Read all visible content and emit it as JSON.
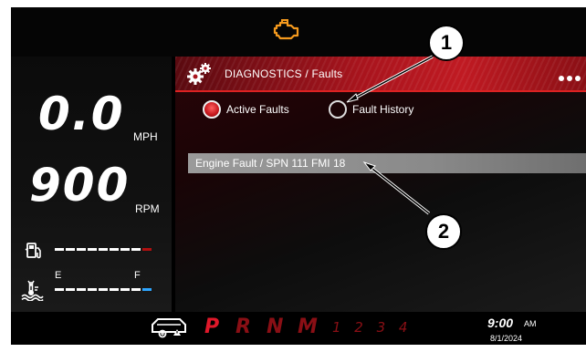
{
  "gauges": {
    "speed_value": "0.0",
    "speed_unit": "MPH",
    "rpm_value": "900",
    "rpm_unit": "RPM",
    "fuel_icon": "fuel-pump-icon",
    "temp_icon": "coolant-temperature-icon",
    "empty_label": "E",
    "full_label": "F"
  },
  "header": {
    "warning_icon": "check-engine-icon"
  },
  "diagnostics": {
    "icon": "gears-icon",
    "title": "DIAGNOSTICS / Faults",
    "options": [
      {
        "label": "Active Faults",
        "selected": true
      },
      {
        "label": "Fault History",
        "selected": false
      }
    ],
    "faults": [
      "Engine Fault / SPN 111 FMI 18"
    ]
  },
  "footer": {
    "transmission_icon": "transmission-warning-icon",
    "gears": [
      "P",
      "R",
      "N",
      "M"
    ],
    "gear_numbers": "1 2 3 4",
    "time": "9:00",
    "ampm": "AM",
    "date": "8/1/2024"
  },
  "callouts": [
    "1",
    "2"
  ],
  "colors": {
    "accent_red": "#c01a22",
    "active_gear": "#e0182a",
    "inactive_gear": "#8a0f15",
    "warning_orange": "#f59a1e",
    "fuel_bar_end": "#b01010",
    "temp_bar_end": "#2ea6ff"
  }
}
